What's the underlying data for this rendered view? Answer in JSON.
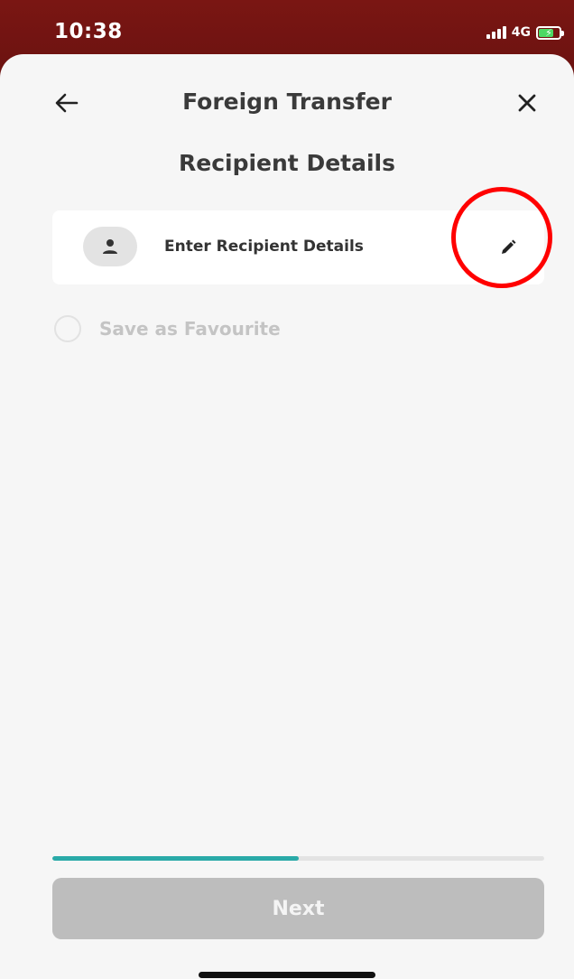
{
  "status_bar": {
    "time": "10:38",
    "network": "4G",
    "signal_bars": 4,
    "battery_icon": "battery-charging-icon"
  },
  "header": {
    "title": "Foreign Transfer",
    "back_icon": "arrow-left-icon",
    "close_icon": "close-icon"
  },
  "section": {
    "title": "Recipient Details"
  },
  "recipient_card": {
    "label": "Enter Recipient Details",
    "avatar_icon": "person-icon",
    "edit_icon": "pencil-icon"
  },
  "favourite": {
    "label": "Save as Favourite",
    "checked": false
  },
  "progress": {
    "fraction": 0.5
  },
  "footer": {
    "next_label": "Next"
  },
  "colors": {
    "status_bar": "#7a1613",
    "accent": "#2aaaa8",
    "highlight": "#ff0000",
    "disabled_button": "#bdbdbd"
  }
}
